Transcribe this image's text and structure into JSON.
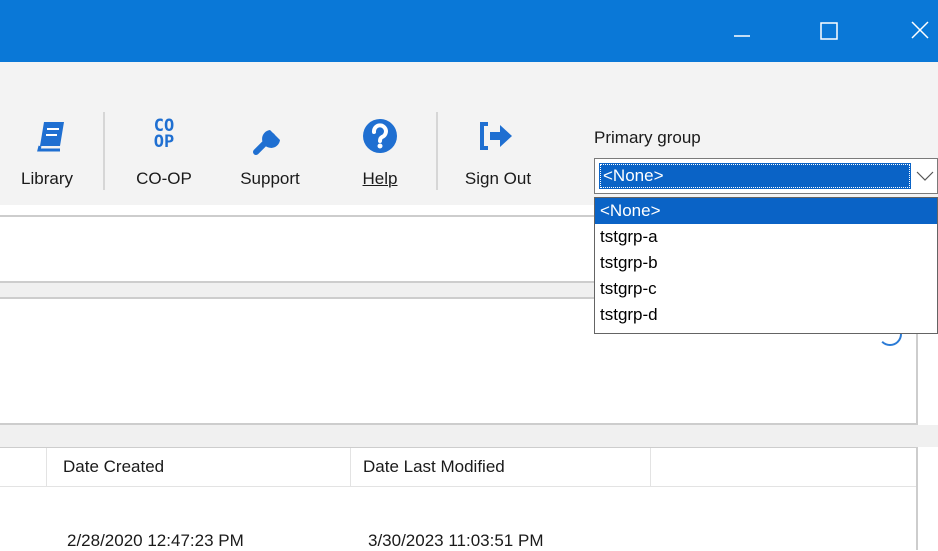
{
  "toolbar": {
    "library_label": "Library",
    "coop_label": "CO-OP",
    "coop_icon_text": "CO OP",
    "support_label": "Support",
    "help_label": "Help",
    "signout_label": "Sign Out"
  },
  "primary_group": {
    "label": "Primary group",
    "selected": "<None>",
    "options": [
      "<None>",
      "tstgrp-a",
      "tstgrp-b",
      "tstgrp-c",
      "tstgrp-d"
    ]
  },
  "grid": {
    "headers": [
      "Date Created",
      "Date Last Modified"
    ],
    "rows": [
      [
        "2/28/2020 12:47:23 PM",
        "3/30/2023 11:03:51 PM"
      ]
    ]
  },
  "colors": {
    "titlebar": "#0a78d7",
    "accent": "#0a63c6",
    "icon_blue": "#1f6fd1"
  }
}
